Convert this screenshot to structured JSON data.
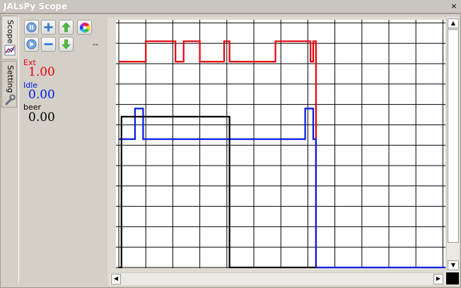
{
  "window": {
    "title": "JALsPy Scope",
    "close_symbol": "×"
  },
  "tabs": [
    {
      "label": "Scope",
      "icon": "chart-icon"
    },
    {
      "label": "Setting",
      "icon": "wrench-icon"
    }
  ],
  "toolbar": {
    "buttons": [
      {
        "name": "pause-button",
        "icon": "pause-icon"
      },
      {
        "name": "zoom-in-button",
        "icon": "plus-icon"
      },
      {
        "name": "move-up-button",
        "icon": "arrow-up-icon"
      },
      {
        "name": "color-button",
        "icon": "color-wheel-icon"
      },
      {
        "name": "play-button",
        "icon": "play-icon"
      },
      {
        "name": "zoom-out-button",
        "icon": "minus-icon"
      },
      {
        "name": "move-down-button",
        "icon": "arrow-down-icon"
      }
    ],
    "extra_text": "--"
  },
  "channels": [
    {
      "name": "Ext",
      "value": "1.00",
      "color": "#e8000b"
    },
    {
      "name": "Idle",
      "value": "0.00",
      "color": "#0019e6"
    },
    {
      "name": "beer",
      "value": "0.00",
      "color": "#000000"
    }
  ],
  "scope": {
    "grid_columns": 12,
    "grid_rows": 12,
    "traces": [
      {
        "channel": "Ext",
        "color": "#e8000b",
        "points": [
          [
            0,
            10.1
          ],
          [
            1,
            10.1
          ],
          [
            1,
            11.1
          ],
          [
            2.1,
            11.1
          ],
          [
            2.1,
            10.1
          ],
          [
            2.4,
            10.1
          ],
          [
            2.4,
            11.1
          ],
          [
            3,
            11.1
          ],
          [
            3,
            10.1
          ],
          [
            3.9,
            10.1
          ],
          [
            3.9,
            11.1
          ],
          [
            4.1,
            11.1
          ],
          [
            4.1,
            10.1
          ],
          [
            5.8,
            10.1
          ],
          [
            5.8,
            11.1
          ],
          [
            7.1,
            11.1
          ],
          [
            7.1,
            10.1
          ],
          [
            7.2,
            10.1
          ],
          [
            7.2,
            11.1
          ],
          [
            7.3,
            11.1
          ],
          [
            7.3,
            0
          ]
        ]
      },
      {
        "channel": "Idle",
        "color": "#0019e6",
        "points": [
          [
            0,
            6.3
          ],
          [
            0.6,
            6.3
          ],
          [
            0.6,
            7.8
          ],
          [
            0.9,
            7.8
          ],
          [
            0.9,
            6.3
          ],
          [
            6.9,
            6.3
          ],
          [
            6.9,
            7.8
          ],
          [
            7.2,
            7.8
          ],
          [
            7.2,
            6.3
          ],
          [
            7.3,
            6.3
          ],
          [
            7.3,
            0
          ],
          [
            12.3,
            0
          ]
        ]
      },
      {
        "channel": "beer",
        "color": "#000000",
        "points": [
          [
            0,
            0
          ],
          [
            0.1,
            0
          ],
          [
            0.1,
            7.4
          ],
          [
            4.1,
            7.4
          ],
          [
            4.1,
            0
          ],
          [
            7.3,
            0
          ]
        ]
      }
    ]
  }
}
